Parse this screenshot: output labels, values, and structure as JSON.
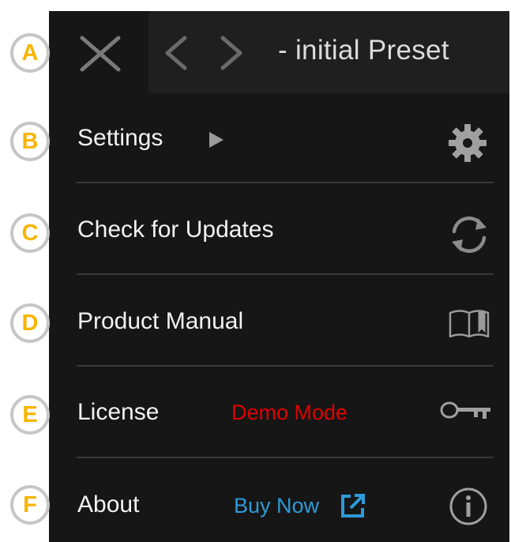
{
  "header": {
    "preset_name": "- initial Preset",
    "close_icon": "close-icon",
    "prev_icon": "chevron-left-icon",
    "next_icon": "chevron-right-icon"
  },
  "menu": {
    "settings": {
      "label": "Settings",
      "icon": "gear-icon",
      "submenu_icon": "triangle-right-icon"
    },
    "updates": {
      "label": "Check for Updates",
      "icon": "refresh-icon"
    },
    "manual": {
      "label": "Product Manual",
      "icon": "book-icon"
    },
    "license": {
      "label": "License",
      "status": "Demo Mode",
      "icon": "key-icon"
    },
    "about": {
      "label": "About",
      "link": "Buy Now",
      "link_icon": "external-link-icon",
      "icon": "info-icon"
    }
  },
  "callouts": [
    "A",
    "B",
    "C",
    "D",
    "E",
    "F"
  ],
  "colors": {
    "panel_bg": "#161616",
    "preset_bg": "#1f1f1f",
    "text": "#f2f2f2",
    "icon": "#a0a0a0",
    "demo_red": "#e00000",
    "buy_blue": "#2d9ad8",
    "callout_yellow": "#f7b500",
    "callout_ring": "#c6c6c6"
  }
}
